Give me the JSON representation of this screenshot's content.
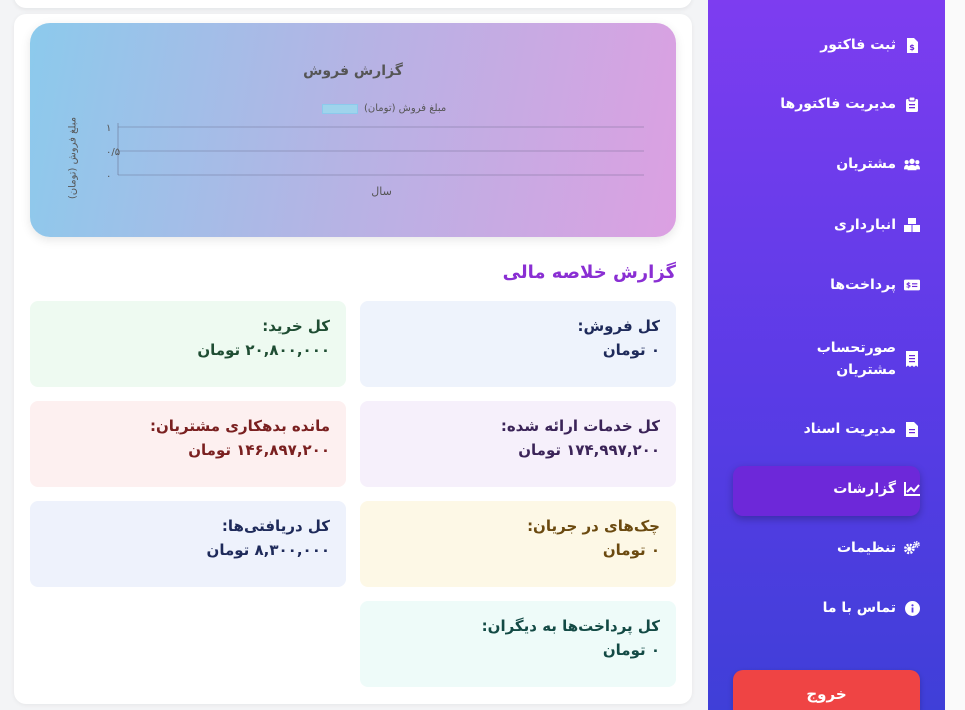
{
  "sidebar": {
    "items": [
      {
        "label": "ثبت فاکتور",
        "icon": "invoice-dollar-icon"
      },
      {
        "label": "مدیریت فاکتورها",
        "icon": "clipboard-icon"
      },
      {
        "label": "مشتریان",
        "icon": "users-icon"
      },
      {
        "label": "انبارداری",
        "icon": "boxes-icon"
      },
      {
        "label": "پرداخت‌ها",
        "icon": "money-bill-icon"
      },
      {
        "label": "صورتحساب",
        "label2": "مشتریان",
        "icon": "receipt-icon"
      },
      {
        "label": "مدیریت اسناد",
        "icon": "file-icon"
      },
      {
        "label": "گزارشات",
        "icon": "chart-line-icon"
      },
      {
        "label": "تنظیمات",
        "icon": "cogs-icon"
      },
      {
        "label": "تماس با ما",
        "icon": "info-circle-icon"
      }
    ],
    "active": "گزارشات",
    "logout_label": "خروج"
  },
  "chart_data": {
    "type": "bar",
    "title": "گزارش فروش",
    "legend": [
      "مبلغ فروش (تومان)"
    ],
    "series": [
      {
        "name": "مبلغ فروش (تومان)",
        "values": []
      }
    ],
    "categories": [],
    "xlabel": "سال",
    "ylabel": "مبلغ فروش (تومان)",
    "yticks": [
      "۱",
      "۰/۵",
      "۰"
    ],
    "ylim": [
      0,
      1
    ],
    "grid": true,
    "legend_position": "top-center",
    "colors": {
      "series": "#9fd4ec"
    }
  },
  "summary": {
    "heading": "گزارش خلاصه مالی",
    "tiles": [
      {
        "label": "کل فروش:",
        "value": "۰ تومان",
        "bg": "#eef3fc",
        "color": "#1e2a5a"
      },
      {
        "label": "کل خرید:",
        "value": "۲۰,۸۰۰,۰۰۰ تومان",
        "bg": "#eefaf1",
        "color": "#1f4d33"
      },
      {
        "label": "کل خدمات ارائه شده:",
        "value": "۱۷۴,۹۹۷,۲۰۰ تومان",
        "bg": "#f6f0fb",
        "color": "#3b2458"
      },
      {
        "label": "مانده بدهکاری مشتریان:",
        "value": "۱۴۶,۸۹۷,۲۰۰ تومان",
        "bg": "#fdf0f0",
        "color": "#7a2020"
      },
      {
        "label": "چک‌های در جریان:",
        "value": "۰ تومان",
        "bg": "#fdf8e6",
        "color": "#6b4a10"
      },
      {
        "label": "کل دریافتی‌ها:",
        "value": "۸,۳۰۰,۰۰۰ تومان",
        "bg": "#eef2fc",
        "color": "#1e2a5a"
      },
      {
        "label": "کل پرداخت‌ها به دیگران:",
        "value": "۰ تومان",
        "bg": "#eefbf9",
        "color": "#134a45"
      }
    ]
  }
}
